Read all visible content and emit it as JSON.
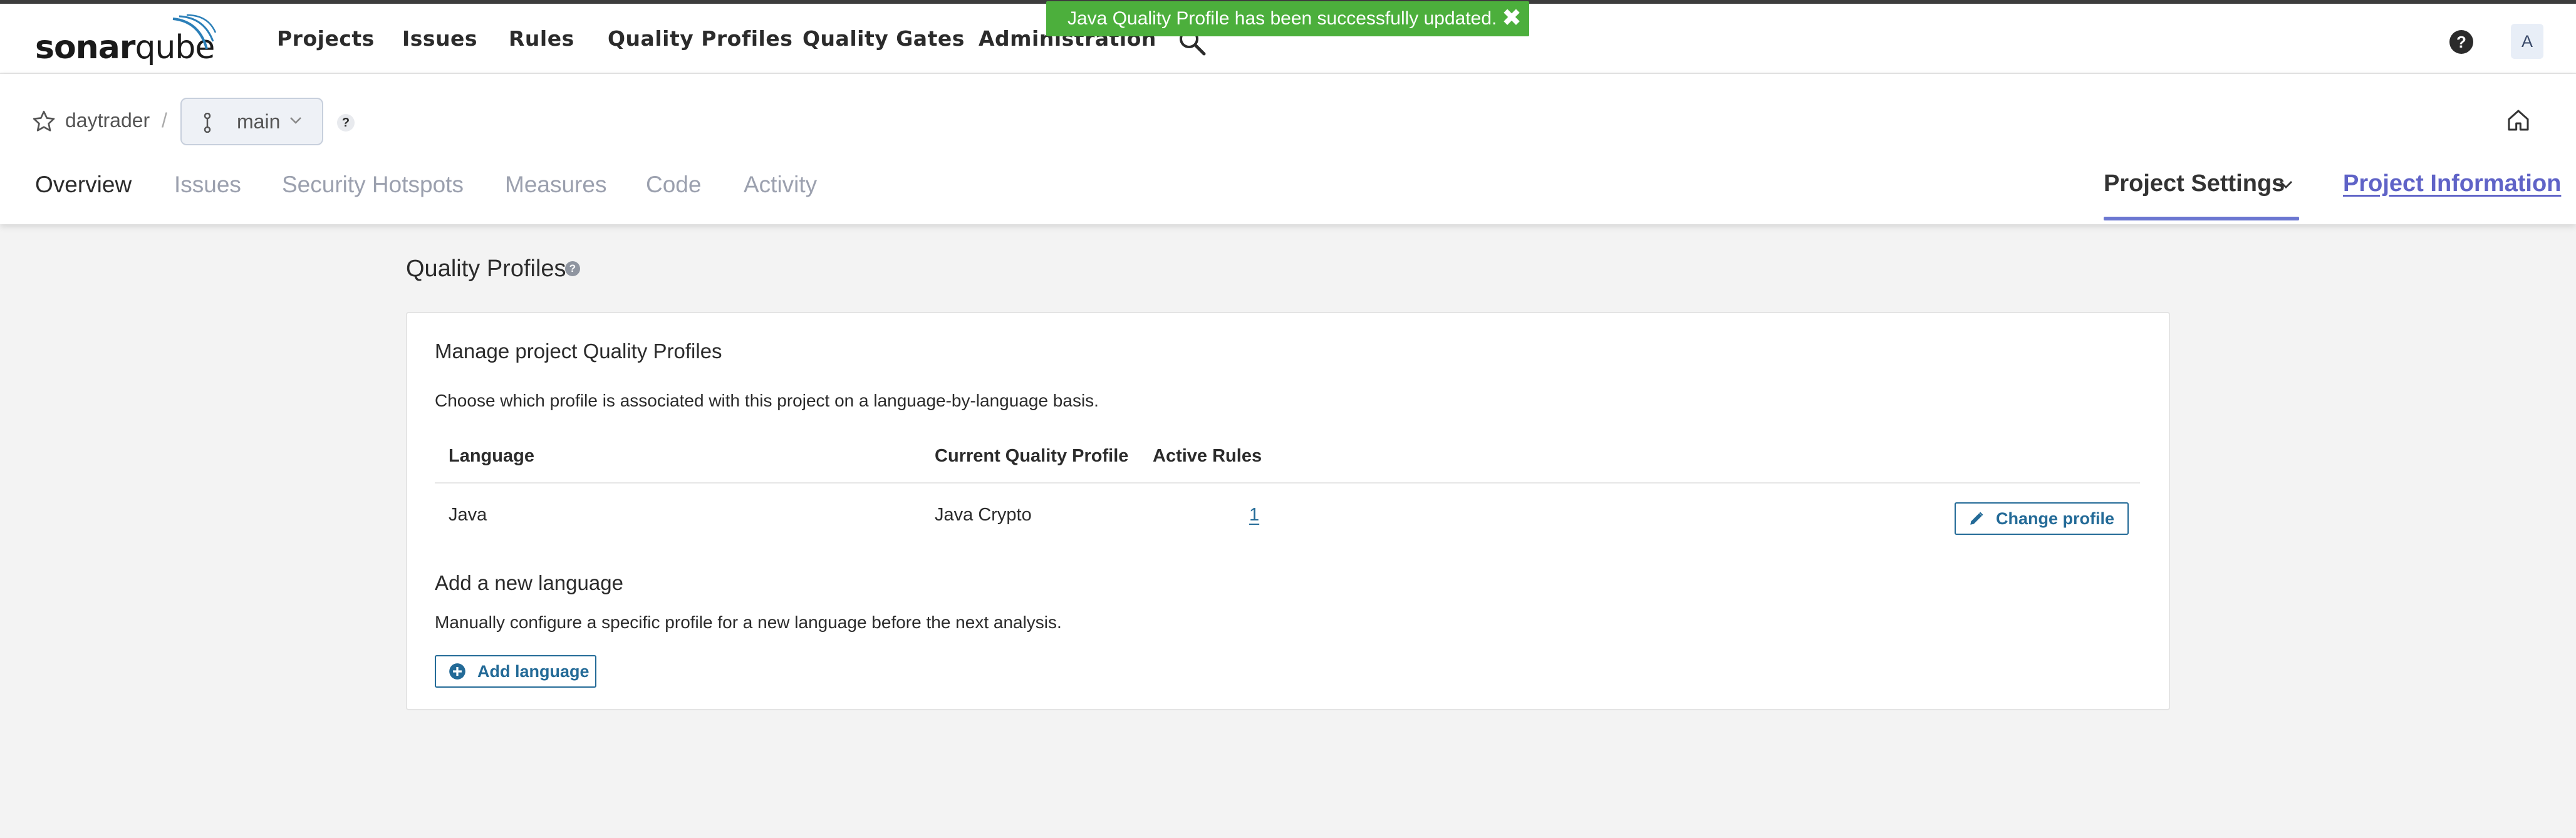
{
  "app": {
    "logo_text_bold": "sonar",
    "logo_text_light": "qube"
  },
  "topnav": {
    "items": [
      "Projects",
      "Issues",
      "Rules",
      "Quality Profiles",
      "Quality Gates",
      "Administration"
    ],
    "help_label": "?",
    "avatar_initial": "A"
  },
  "toast": {
    "message": "Java Quality Profile has been successfully updated.",
    "close_label": "✖"
  },
  "project": {
    "name": "daytrader",
    "separator": "/",
    "branch": "main",
    "branch_help": "?"
  },
  "tabs": {
    "items": [
      "Overview",
      "Issues",
      "Security Hotspots",
      "Measures",
      "Code",
      "Activity"
    ],
    "active": "Overview",
    "project_settings": "Project Settings",
    "project_information": "Project Information"
  },
  "main": {
    "page_title": "Quality Profiles",
    "page_title_help": "?",
    "card": {
      "title": "Manage project Quality Profiles",
      "description": "Choose which profile is associated with this project on a language-by-language basis.",
      "columns": [
        "Language",
        "Current Quality Profile",
        "Active Rules"
      ],
      "rows": [
        {
          "language": "Java",
          "profile": "Java Crypto",
          "active_rules": "1",
          "action": "Change profile"
        }
      ],
      "add_section_title": "Add a new language",
      "add_section_desc": "Manually configure a specific profile for a new language before the next analysis.",
      "add_button": "Add language"
    }
  },
  "colors": {
    "toast_bg": "#4caf3c",
    "accent_purple": "#5f63c7",
    "settings_underline": "#6b77d1",
    "link_blue": "#236a97",
    "page_bg": "#f3f3f3"
  },
  "icons": [
    "logo-arc-icon",
    "search-icon",
    "help-icon",
    "star-icon",
    "branch-icon",
    "chevron-down-icon",
    "home-icon",
    "pencil-icon",
    "plus-circle-icon",
    "close-icon"
  ]
}
